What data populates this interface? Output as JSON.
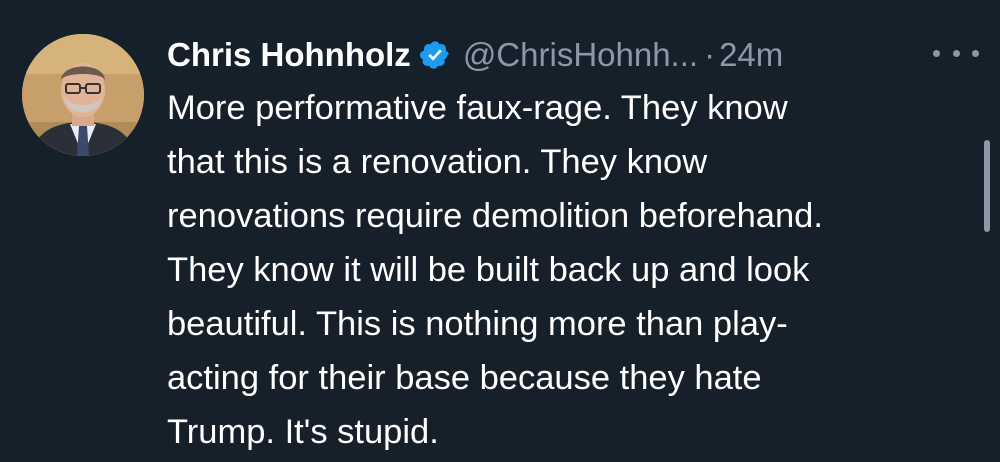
{
  "author": {
    "display_name": "Chris Hohnholz",
    "handle": "@ChrisHohnh...",
    "verified": true,
    "avatar_icon": "profile-photo"
  },
  "meta": {
    "separator": "·",
    "time_ago": "24m"
  },
  "tweet": {
    "lines": [
      "More performative faux-rage. They know",
      "that this is a renovation. They know",
      "renovations require demolition beforehand.",
      "They know it will be built back up and look",
      "beautiful. This is nothing more than play-",
      "acting for their base because they hate",
      "Trump. It's stupid."
    ]
  },
  "icons": {
    "verified": "verified-badge-icon",
    "more": "more-options-icon"
  },
  "colors": {
    "background": "#15202b",
    "primary_text": "#ffffff",
    "secondary_text": "#8b98a5",
    "verified_blue": "#1d9bf0"
  }
}
